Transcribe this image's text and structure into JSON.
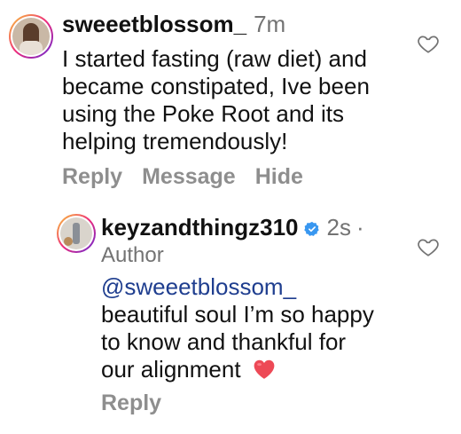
{
  "comments": [
    {
      "username": "sweeetblossom_",
      "time": "7m",
      "lines": [
        "I started fasting (raw diet) and",
        "became constipated, Ive been",
        "using the Poke Root and its",
        "helping tremendously!"
      ],
      "actions": {
        "reply": "Reply",
        "message": "Message",
        "hide": "Hide"
      }
    }
  ],
  "reply": {
    "username": "keyzandthingz310",
    "time": "2s",
    "separator": "·",
    "author_label": "Author",
    "mention": "@sweeetblossom_",
    "lines": [
      "beautiful soul I’m so happy",
      "to know and thankful for",
      "our alignment"
    ],
    "emoji": "red-heart-emoji",
    "actions": {
      "reply": "Reply"
    }
  },
  "icons": {
    "like": "heart-outline-icon",
    "verified": "verified-badge-icon"
  },
  "colors": {
    "text": "#111111",
    "muted": "#737373",
    "action": "#8e8e8e",
    "mention": "#1f3e8f",
    "verified": "#3897f0",
    "heart": "#ed4956"
  }
}
